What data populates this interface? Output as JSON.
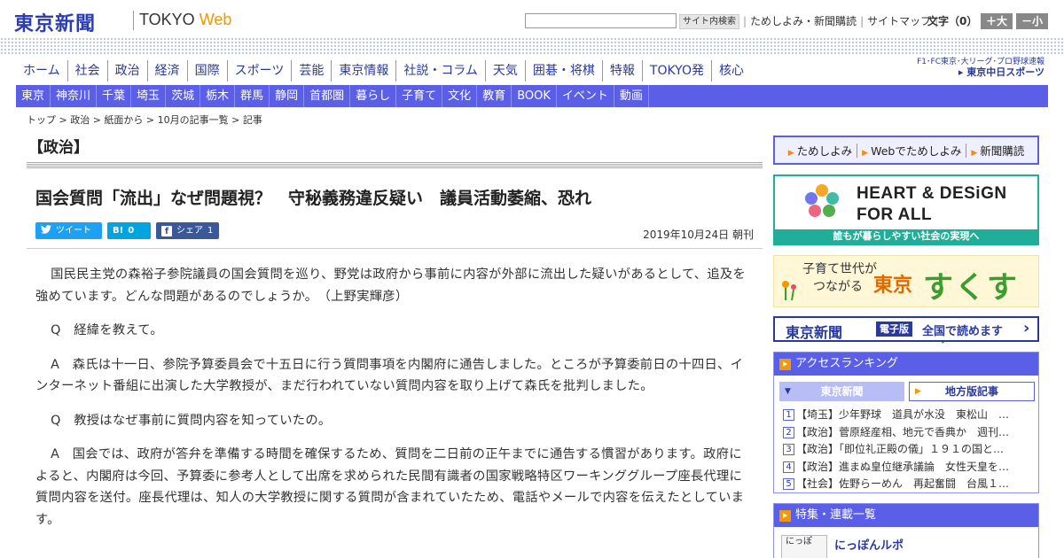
{
  "header": {
    "logo": "東京新聞",
    "logo_tokyo": "TOKYO ",
    "logo_web": "Web",
    "search_button": "サイト内検索",
    "links": [
      "ためしよみ・新聞購読",
      "サイトマップ"
    ],
    "font_size_label": "文字（0）",
    "font_plus": "＋大",
    "font_minus": "－小"
  },
  "main_nav": [
    "ホーム",
    "社会",
    "政治",
    "経済",
    "国際",
    "スポーツ",
    "芸能",
    "東京情報",
    "社説・コラム",
    "天気",
    "囲碁・将棋",
    "特報",
    "TOKYO発",
    "核心"
  ],
  "chunichi": {
    "tagline": "F1･FC東京･大リーグ･プロ野球速報",
    "logo": "▸ 東京中日スポーツ"
  },
  "sub_nav": [
    "東京",
    "神奈川",
    "千葉",
    "埼玉",
    "茨城",
    "栃木",
    "群馬",
    "静岡",
    "首都圏",
    "暮らし",
    "子育て",
    "文化",
    "教育",
    "BOOK",
    "イベント",
    "動画"
  ],
  "breadcrumb": [
    "トップ",
    "政治",
    "紙面から",
    "10月の記事一覧",
    "記事"
  ],
  "breadcrumb_sep": " > ",
  "article": {
    "section": "【政治】",
    "title": "国会質問「流出」なぜ問題視？　守秘義務違反疑い　議員活動萎縮、恐れ",
    "date": "2019年10月24日 朝刊",
    "social": {
      "tweet_label": "ツイート",
      "hatena_label": "B!",
      "hatena_count": "0",
      "share_label": "シェア",
      "share_count": "1"
    },
    "paragraphs": [
      "国民民主党の森裕子参院議員の国会質問を巡り、野党は政府から事前に内容が外部に流出した疑いがあるとして、追及を強めています。どんな問題があるのでしょうか。　（上野実輝彦）",
      "Q　経緯を教えて。",
      "A　森氏は十一日、参院予算委員会で十五日に行う質問事項を内閣府に通告しました。ところが予算委前日の十四日、インターネット番組に出演した大学教授が、まだ行われていない質問内容を取り上げて森氏を批判しました。",
      "Q　教授はなぜ事前に質問内容を知っていたの。",
      "A　国会では、政府が答弁を準備する時間を確保するため、質問を二日前の正午までに通告する慣習があります。政府によると、内閣府は今回、予算委に参考人として出席を求められた民間有識者の国家戦略特区ワーキンググループ座長代理に質問内容を送付。座長代理は、知人の大学教授に関する質問が含まれていたため、電話やメールで内容を伝えたとしています。"
    ]
  },
  "sidebar": {
    "tameshi": [
      "ためしよみ",
      "Webでためしよみ",
      "新聞購読"
    ],
    "heart_design": {
      "line1": "HEART & DESiGN",
      "line2": "FOR ALL",
      "bottom": "誰もが暮らしやすい社会の実現へ"
    },
    "sukusuku": {
      "line1": "子育て世代が",
      "line2": "つながる",
      "tokyo": "東京",
      "big": "すくすく"
    },
    "denshi": {
      "logo": "東京新聞",
      "tag": "電子版",
      "text": "全国で読めます"
    },
    "ranking": {
      "heading": "アクセスランキング",
      "tab_tokyo": "東京新聞",
      "tab_local": "地方版記事",
      "items": [
        {
          "num": "1",
          "text": "【埼玉】少年野球　道具が水没　東松山　…"
        },
        {
          "num": "2",
          "text": "【政治】菅原経産相、地元で香典か　週刊…"
        },
        {
          "num": "3",
          "text": "【政治】「即位礼正殿の儀」１９１の国と…"
        },
        {
          "num": "4",
          "text": "【政治】進まぬ皇位継承議論　女性天皇を…"
        },
        {
          "num": "5",
          "text": "【社会】佐野らーめん　再起奮闘　台風１…"
        }
      ]
    },
    "tokushu": {
      "heading": "特集・連載一覧",
      "thumb": "にっぽ",
      "item": "にっぽんルポ"
    }
  },
  "colors": {
    "brand_blue": "#2c3cb3",
    "nav_purple": "#5b5fe8",
    "accent_orange": "#f39800",
    "teal": "#1faf98",
    "green": "#3a9e2e"
  }
}
